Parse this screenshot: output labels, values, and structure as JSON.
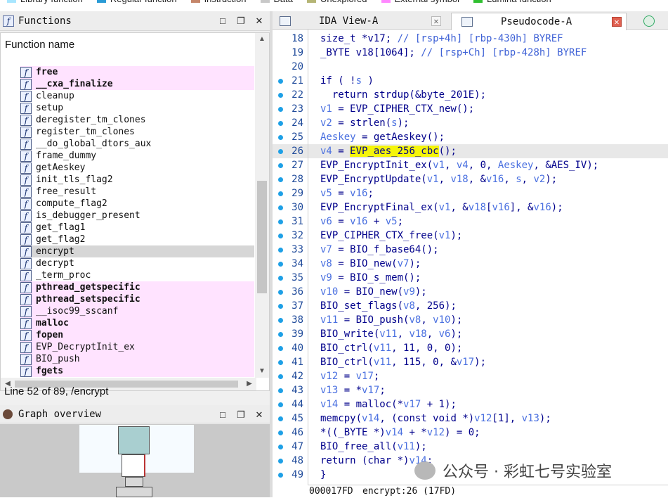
{
  "legend": [
    "Library function",
    "Regular function",
    "Instruction",
    "Data",
    "Unexplored",
    "External symbol",
    "Lumina function"
  ],
  "legend_colors": [
    "#a8e6ff",
    "#2a9bd6",
    "#c5866a",
    "#c8c8c8",
    "#b5b575",
    "#ff88ff",
    "#30c030"
  ],
  "functions_panel": {
    "title": "Functions",
    "column_header": "Function name",
    "items": [
      {
        "name": "free",
        "external": true,
        "bold": true
      },
      {
        "name": "__cxa_finalize",
        "external": true,
        "bold": true
      },
      {
        "name": "cleanup",
        "external": false,
        "bold": false
      },
      {
        "name": "setup",
        "external": false,
        "bold": false
      },
      {
        "name": "deregister_tm_clones",
        "external": false,
        "bold": false
      },
      {
        "name": "register_tm_clones",
        "external": false,
        "bold": false
      },
      {
        "name": "__do_global_dtors_aux",
        "external": false,
        "bold": false
      },
      {
        "name": "frame_dummy",
        "external": false,
        "bold": false
      },
      {
        "name": "getAeskey",
        "external": false,
        "bold": false
      },
      {
        "name": "init_tls_flag2",
        "external": false,
        "bold": false
      },
      {
        "name": "free_result",
        "external": false,
        "bold": false
      },
      {
        "name": "compute_flag2",
        "external": false,
        "bold": false
      },
      {
        "name": "is_debugger_present",
        "external": false,
        "bold": false
      },
      {
        "name": "get_flag1",
        "external": false,
        "bold": false
      },
      {
        "name": "get_flag2",
        "external": false,
        "bold": false
      },
      {
        "name": "encrypt",
        "external": false,
        "bold": false,
        "selected": true
      },
      {
        "name": "decrypt",
        "external": false,
        "bold": false
      },
      {
        "name": "_term_proc",
        "external": false,
        "bold": false
      },
      {
        "name": "pthread_getspecific",
        "external": true,
        "bold": true
      },
      {
        "name": "pthread_setspecific",
        "external": true,
        "bold": true
      },
      {
        "name": "__isoc99_sscanf",
        "external": true,
        "bold": false
      },
      {
        "name": "malloc",
        "external": true,
        "bold": true
      },
      {
        "name": "fopen",
        "external": true,
        "bold": true
      },
      {
        "name": "EVP_DecryptInit_ex",
        "external": true,
        "bold": false
      },
      {
        "name": "BIO_push",
        "external": true,
        "bold": false
      },
      {
        "name": "fgets",
        "external": true,
        "bold": true
      }
    ],
    "status": "Line 52 of 89, /encrypt"
  },
  "graph_panel": {
    "title": "Graph overview"
  },
  "tabs": {
    "ida_view": "IDA View-A",
    "pseudocode": "Pseudocode-A"
  },
  "code_lines": [
    {
      "n": "18",
      "dot": false,
      "html": "size_t *v17; <span class=\"cm\">// [rsp+4h] [rbp-430h] BYREF</span>"
    },
    {
      "n": "19",
      "dot": false,
      "html": "_BYTE v18[1064]; <span class=\"cm\">// [rsp+Ch] [rbp-428h] BYREF</span>"
    },
    {
      "n": "20",
      "dot": false,
      "html": ""
    },
    {
      "n": "21",
      "dot": true,
      "html": "if ( !<span class=\"vr\">s</span> )"
    },
    {
      "n": "22",
      "dot": true,
      "html": "  return strdup(&amp;byte_201E);"
    },
    {
      "n": "23",
      "dot": true,
      "html": "<span class=\"vr\">v1</span> = EVP_CIPHER_CTX_new();"
    },
    {
      "n": "24",
      "dot": true,
      "html": "<span class=\"vr\">v2</span> = strlen(<span class=\"vr\">s</span>);"
    },
    {
      "n": "25",
      "dot": true,
      "html": "<span class=\"vr\">Aeskey</span> = getAeskey();"
    },
    {
      "n": "26",
      "dot": true,
      "hl": true,
      "html": "<span class=\"vr\">v4</span> = <span class=\"ye\">EVP_aes_256_cbc</span>();"
    },
    {
      "n": "27",
      "dot": true,
      "html": "EVP_EncryptInit_ex(<span class=\"vr\">v1</span>, <span class=\"vr\">v4</span>, 0, <span class=\"vr\">Aeskey</span>, &amp;AES_IV);"
    },
    {
      "n": "28",
      "dot": true,
      "html": "EVP_EncryptUpdate(<span class=\"vr\">v1</span>, <span class=\"vr\">v18</span>, &amp;<span class=\"vr\">v16</span>, <span class=\"vr\">s</span>, <span class=\"vr\">v2</span>);"
    },
    {
      "n": "29",
      "dot": true,
      "html": "<span class=\"vr\">v5</span> = <span class=\"vr\">v16</span>;"
    },
    {
      "n": "30",
      "dot": true,
      "html": "EVP_EncryptFinal_ex(<span class=\"vr\">v1</span>, &amp;<span class=\"vr\">v18</span>[<span class=\"vr\">v16</span>], &amp;<span class=\"vr\">v16</span>);"
    },
    {
      "n": "31",
      "dot": true,
      "html": "<span class=\"vr\">v6</span> = <span class=\"vr\">v16</span> + <span class=\"vr\">v5</span>;"
    },
    {
      "n": "32",
      "dot": true,
      "html": "EVP_CIPHER_CTX_free(<span class=\"vr\">v1</span>);"
    },
    {
      "n": "33",
      "dot": true,
      "html": "<span class=\"vr\">v7</span> = BIO_f_base64();"
    },
    {
      "n": "34",
      "dot": true,
      "html": "<span class=\"vr\">v8</span> = BIO_new(<span class=\"vr\">v7</span>);"
    },
    {
      "n": "35",
      "dot": true,
      "html": "<span class=\"vr\">v9</span> = BIO_s_mem();"
    },
    {
      "n": "36",
      "dot": true,
      "html": "<span class=\"vr\">v10</span> = BIO_new(<span class=\"vr\">v9</span>);"
    },
    {
      "n": "37",
      "dot": true,
      "html": "BIO_set_flags(<span class=\"vr\">v8</span>, 256);"
    },
    {
      "n": "38",
      "dot": true,
      "html": "<span class=\"vr\">v11</span> = BIO_push(<span class=\"vr\">v8</span>, <span class=\"vr\">v10</span>);"
    },
    {
      "n": "39",
      "dot": true,
      "html": "BIO_write(<span class=\"vr\">v11</span>, <span class=\"vr\">v18</span>, <span class=\"vr\">v6</span>);"
    },
    {
      "n": "40",
      "dot": true,
      "html": "BIO_ctrl(<span class=\"vr\">v11</span>, 11, 0, 0);"
    },
    {
      "n": "41",
      "dot": true,
      "html": "BIO_ctrl(<span class=\"vr\">v11</span>, 115, 0, &amp;<span class=\"vr\">v17</span>);"
    },
    {
      "n": "42",
      "dot": true,
      "html": "<span class=\"vr\">v12</span> = <span class=\"vr\">v17</span>;"
    },
    {
      "n": "43",
      "dot": true,
      "html": "<span class=\"vr\">v13</span> = *<span class=\"vr\">v17</span>;"
    },
    {
      "n": "44",
      "dot": true,
      "html": "<span class=\"vr\">v14</span> = malloc(*<span class=\"vr\">v17</span> + 1);"
    },
    {
      "n": "45",
      "dot": true,
      "html": "memcpy(<span class=\"vr\">v14</span>, (const void *)<span class=\"vr\">v12</span>[1], <span class=\"vr\">v13</span>);"
    },
    {
      "n": "46",
      "dot": true,
      "html": "*((_BYTE *)<span class=\"vr\">v14</span> + *<span class=\"vr\">v12</span>) = 0;"
    },
    {
      "n": "47",
      "dot": true,
      "html": "BIO_free_all(<span class=\"vr\">v11</span>);"
    },
    {
      "n": "48",
      "dot": true,
      "html": "return (char *)<span class=\"vr\">v14</span>;"
    },
    {
      "n": "49",
      "dot": true,
      "html": "}"
    }
  ],
  "bottom_bar": {
    "address": "000017FD",
    "location": "encrypt:26 (17FD)"
  },
  "watermark": "公众号 · 彩虹七号实验室"
}
